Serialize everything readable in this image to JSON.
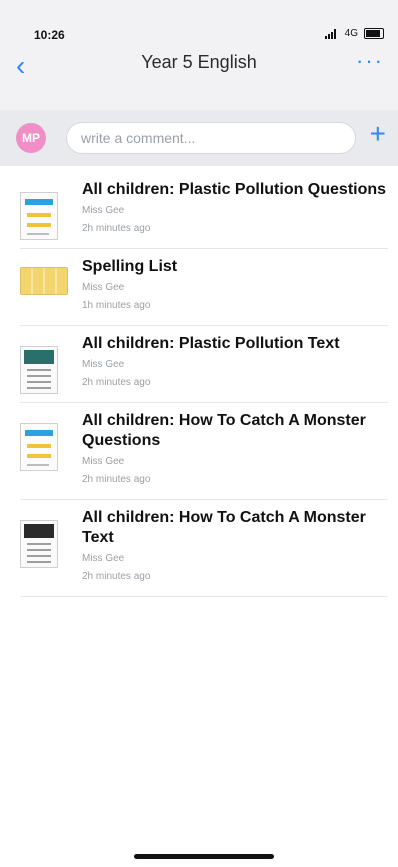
{
  "status_bar": {
    "time": "10:26",
    "network": "4G"
  },
  "nav": {
    "title": "Year 5 English",
    "back_icon": "back-chevron-icon",
    "more_icon": "more-dots-icon"
  },
  "comment_bar": {
    "avatar_initials": "MP",
    "placeholder": "write a comment...",
    "plus_icon": "plus-icon"
  },
  "items": [
    {
      "title": "All children: Plastic Pollution Questions",
      "author": "Miss Gee",
      "time": "2h minutes ago",
      "thumb_type": "doc"
    },
    {
      "title": "Spelling List",
      "author": "Miss Gee",
      "time": "1h minutes ago",
      "thumb_type": "spelling"
    },
    {
      "title": "All children: Plastic Pollution Text",
      "author": "Miss Gee",
      "time": "2h minutes ago",
      "thumb_type": "tile"
    },
    {
      "title": "All children: How To Catch A Monster Questions",
      "author": "Miss Gee",
      "time": "2h minutes ago",
      "thumb_type": "doc"
    },
    {
      "title": "All children: How To Catch A Monster Text",
      "author": "Miss Gee",
      "time": "2h minutes ago",
      "thumb_type": "tile-dark"
    }
  ]
}
